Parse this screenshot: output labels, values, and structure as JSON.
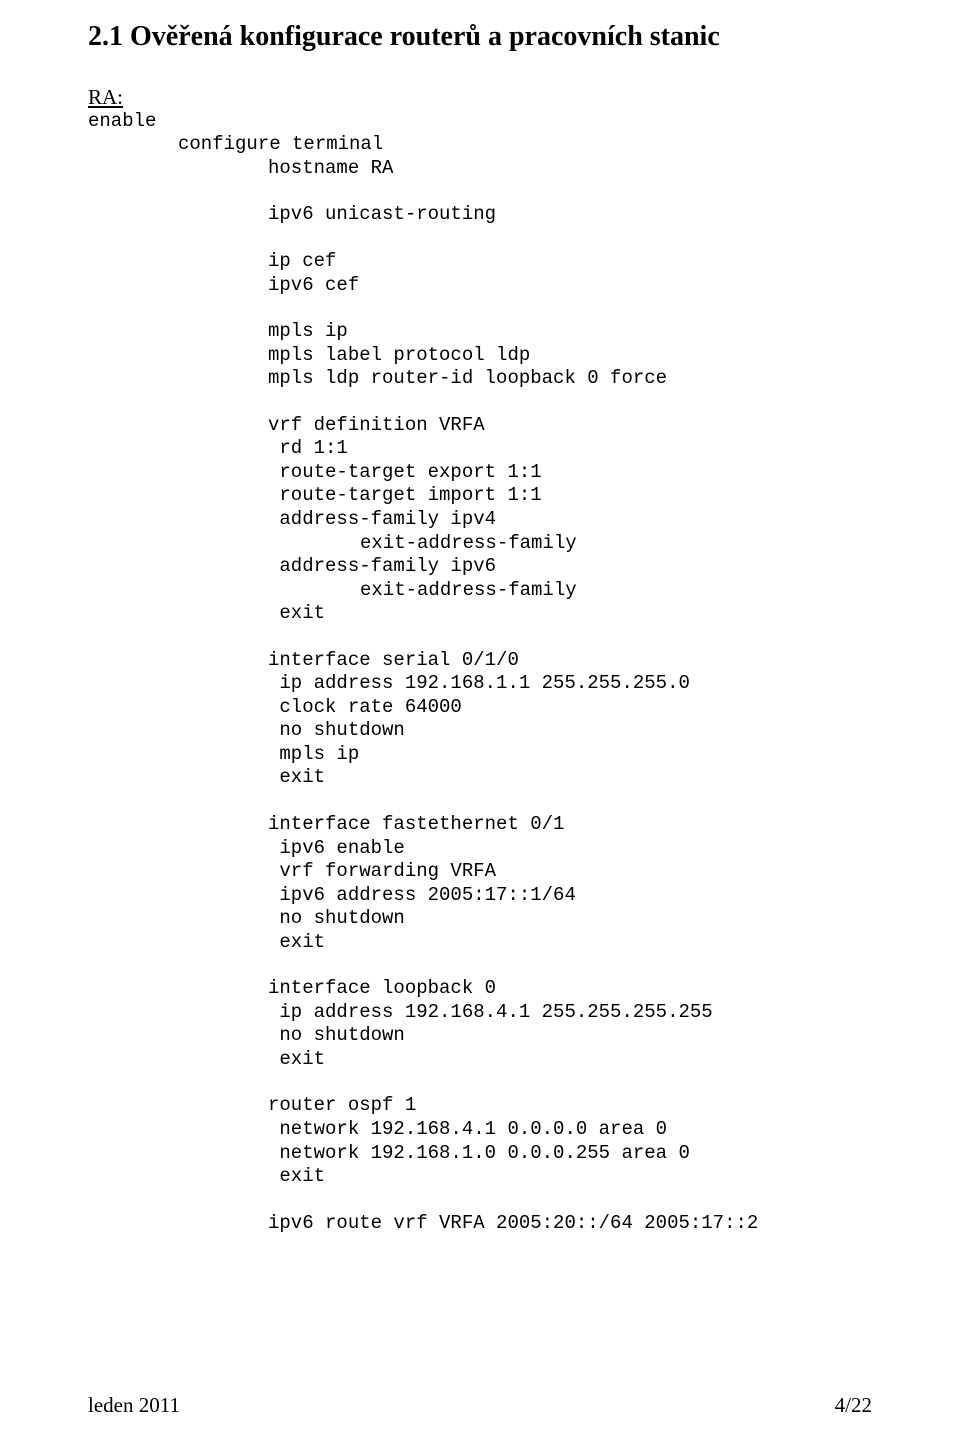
{
  "heading": "2.1  Ověřená konfigurace routerů a pracovních stanic",
  "label": "RA:",
  "lines": [
    {
      "cls": "code",
      "txt": "enable"
    },
    {
      "cls": "code ind1",
      "txt": "configure terminal"
    },
    {
      "cls": "code ind2",
      "txt": "hostname RA"
    },
    {
      "cls": "spacer",
      "txt": ""
    },
    {
      "cls": "code ind2",
      "txt": "ipv6 unicast-routing"
    },
    {
      "cls": "spacer",
      "txt": ""
    },
    {
      "cls": "code ind2",
      "txt": "ip cef"
    },
    {
      "cls": "code ind2",
      "txt": "ipv6 cef"
    },
    {
      "cls": "spacer",
      "txt": ""
    },
    {
      "cls": "code ind2",
      "txt": "mpls ip"
    },
    {
      "cls": "code ind2",
      "txt": "mpls label protocol ldp"
    },
    {
      "cls": "code ind2",
      "txt": "mpls ldp router-id loopback 0 force"
    },
    {
      "cls": "spacer",
      "txt": ""
    },
    {
      "cls": "code ind2",
      "txt": "vrf definition VRFA"
    },
    {
      "cls": "code ind2",
      "txt": " rd 1:1"
    },
    {
      "cls": "code ind2",
      "txt": " route-target export 1:1"
    },
    {
      "cls": "code ind2",
      "txt": " route-target import 1:1"
    },
    {
      "cls": "code ind2",
      "txt": " address-family ipv4"
    },
    {
      "cls": "code ind3",
      "txt": "exit-address-family"
    },
    {
      "cls": "code ind2",
      "txt": " address-family ipv6"
    },
    {
      "cls": "code ind3",
      "txt": "exit-address-family"
    },
    {
      "cls": "code ind2",
      "txt": " exit"
    },
    {
      "cls": "spacer",
      "txt": ""
    },
    {
      "cls": "code ind2",
      "txt": "interface serial 0/1/0"
    },
    {
      "cls": "code ind2",
      "txt": " ip address 192.168.1.1 255.255.255.0"
    },
    {
      "cls": "code ind2",
      "txt": " clock rate 64000"
    },
    {
      "cls": "code ind2",
      "txt": " no shutdown"
    },
    {
      "cls": "code ind2",
      "txt": " mpls ip"
    },
    {
      "cls": "code ind2",
      "txt": " exit"
    },
    {
      "cls": "spacer",
      "txt": ""
    },
    {
      "cls": "code ind2",
      "txt": "interface fastethernet 0/1"
    },
    {
      "cls": "code ind2",
      "txt": " ipv6 enable"
    },
    {
      "cls": "code ind2",
      "txt": " vrf forwarding VRFA"
    },
    {
      "cls": "code ind2",
      "txt": " ipv6 address 2005:17::1/64"
    },
    {
      "cls": "code ind2",
      "txt": " no shutdown"
    },
    {
      "cls": "code ind2",
      "txt": " exit"
    },
    {
      "cls": "spacer",
      "txt": ""
    },
    {
      "cls": "code ind2",
      "txt": "interface loopback 0"
    },
    {
      "cls": "code ind2",
      "txt": " ip address 192.168.4.1 255.255.255.255"
    },
    {
      "cls": "code ind2",
      "txt": " no shutdown"
    },
    {
      "cls": "code ind2",
      "txt": " exit"
    },
    {
      "cls": "spacer",
      "txt": ""
    },
    {
      "cls": "code ind2",
      "txt": "router ospf 1"
    },
    {
      "cls": "code ind2",
      "txt": " network 192.168.4.1 0.0.0.0 area 0"
    },
    {
      "cls": "code ind2",
      "txt": " network 192.168.1.0 0.0.0.255 area 0"
    },
    {
      "cls": "code ind2",
      "txt": " exit"
    },
    {
      "cls": "spacer",
      "txt": ""
    },
    {
      "cls": "code ind2",
      "txt": "ipv6 route vrf VRFA 2005:20::/64 2005:17::2"
    }
  ],
  "footer_left": "leden 2011",
  "footer_right": "4/22"
}
